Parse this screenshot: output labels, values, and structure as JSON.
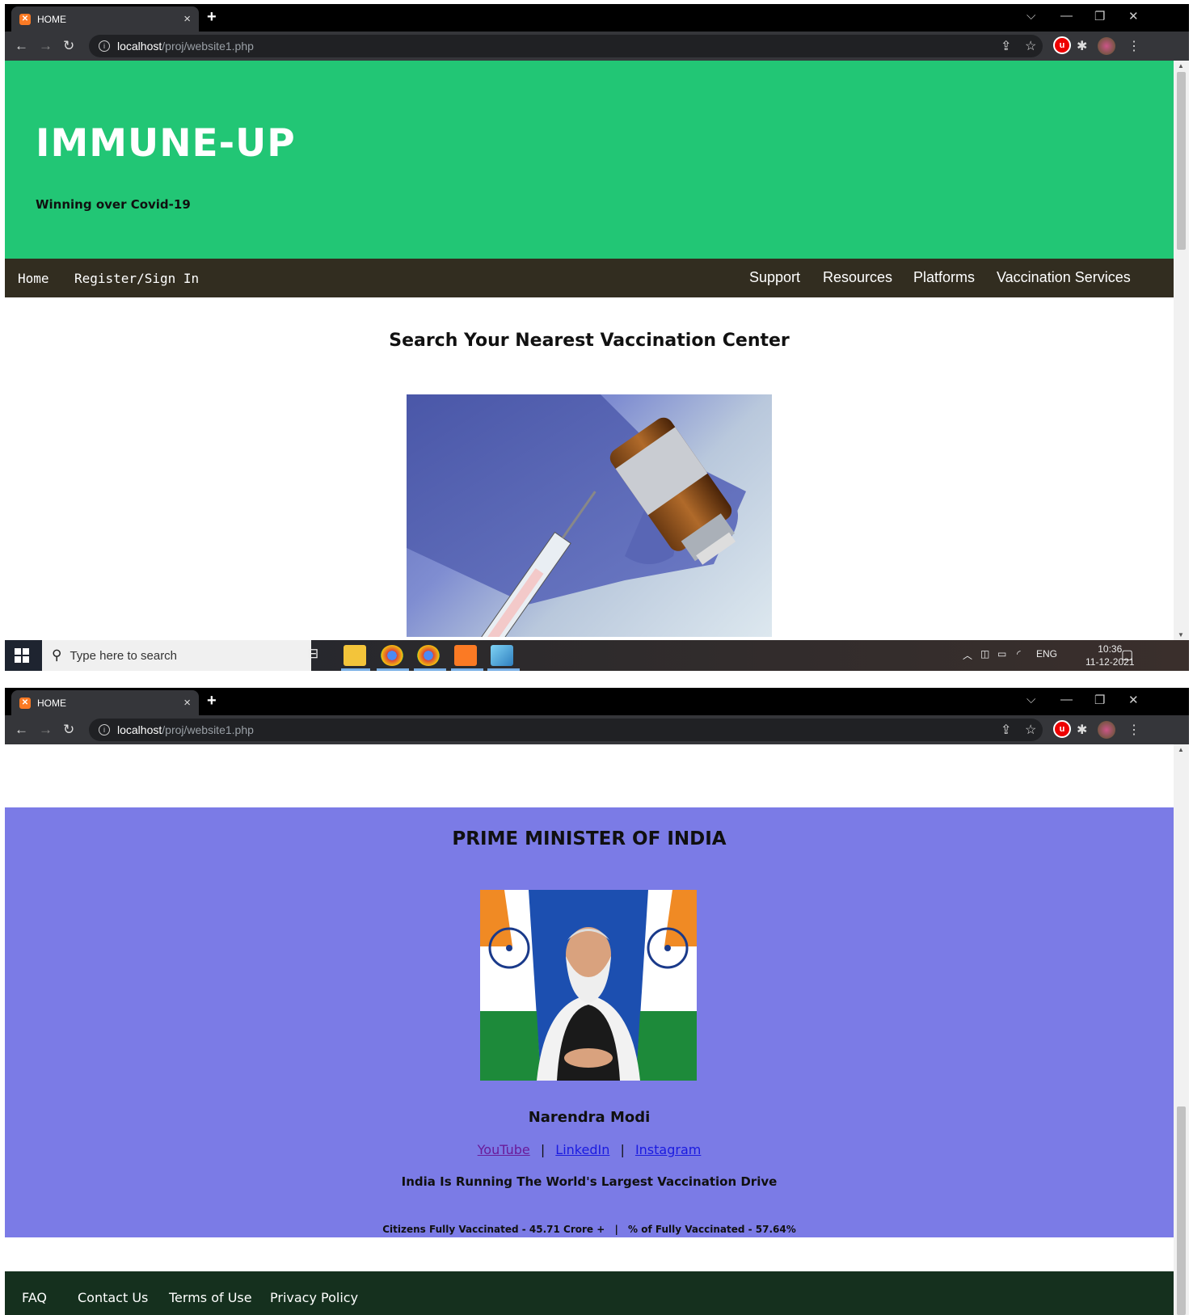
{
  "browser": {
    "tab_title": "HOME",
    "new_tab": "+",
    "url_host": "localhost",
    "url_path": "/proj/website1.php"
  },
  "site": {
    "title": "IMMUNE-UP",
    "tagline": "Winning over Covid-19",
    "nav_left": [
      "Home",
      "Register/Sign In"
    ],
    "nav_right": [
      "Support",
      "Resources",
      "Platforms",
      "Vaccination Services"
    ],
    "search_heading": "Search Your Nearest Vaccination Center"
  },
  "pm_section": {
    "title": "PRIME MINISTER OF INDIA",
    "name": "Narendra Modi",
    "links": [
      "YouTube",
      "LinkedIn",
      "Instagram"
    ],
    "separator": "|",
    "drive_text": "India Is Running The World's Largest Vaccination Drive",
    "stat1": "Citizens Fully Vaccinated - 45.71 Crore +",
    "stat2": "% of Fully Vaccinated - 57.64%"
  },
  "footer": {
    "links": [
      "FAQ",
      "Contact Us",
      "Terms of Use",
      "Privacy Policy"
    ]
  },
  "taskbar": {
    "search_placeholder": "Type here to search",
    "lang": "ENG",
    "time": "10:36",
    "date": "11-12-2021"
  },
  "colors": {
    "hero_green": "#22c675",
    "nav_dark": "#322d20",
    "pm_purple": "#7b7be6",
    "footer_dark": "#15301e"
  }
}
